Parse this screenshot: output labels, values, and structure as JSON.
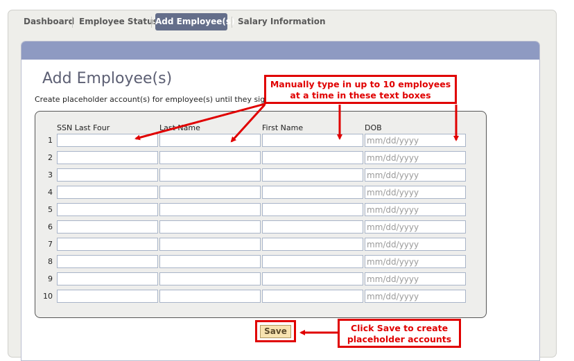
{
  "tabs": [
    {
      "label": "Dashboard",
      "active": false
    },
    {
      "label": "Employee Status",
      "active": false
    },
    {
      "label": "Add Employee(s)",
      "active": true
    },
    {
      "label": "Salary Information",
      "active": false
    }
  ],
  "page": {
    "title": "Add Employee(s)",
    "subtitle": "Create placeholder account(s) for employee(s) until they signup."
  },
  "form": {
    "columns": [
      "SSN Last Four",
      "Last Name",
      "First Name",
      "DOB"
    ],
    "rows": [
      "1",
      "2",
      "3",
      "4",
      "5",
      "6",
      "7",
      "8",
      "9",
      "10"
    ],
    "dob_placeholder": "mm/dd/yyyy",
    "save_label": "Save"
  },
  "annotations": {
    "top_line1": "Manually type in up to 10 employees",
    "top_line2": "at a time in these text boxes",
    "save_line1": "Click Save to create",
    "save_line2": "placeholder accounts"
  },
  "colors": {
    "accent": "#646e8a",
    "panel_header": "#8e9ac2",
    "annotation": "#e00000"
  }
}
